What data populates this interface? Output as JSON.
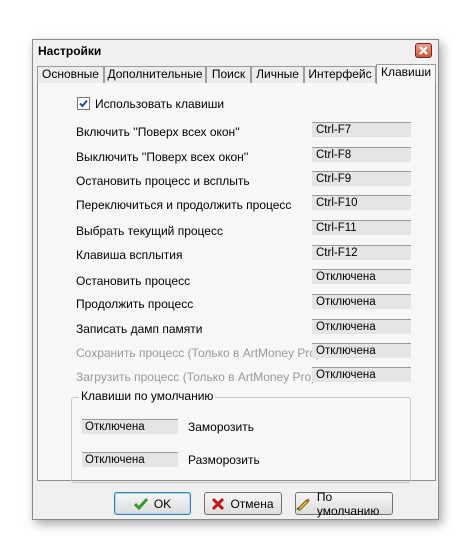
{
  "window": {
    "title": "Настройки"
  },
  "tabs": [
    {
      "label": "Основные"
    },
    {
      "label": "Дополнительные"
    },
    {
      "label": "Поиск"
    },
    {
      "label": "Личные"
    },
    {
      "label": "Интерфейс"
    },
    {
      "label": "Клавиши",
      "active": true
    }
  ],
  "use_hotkeys": {
    "label": "Использовать клавиши",
    "checked": true
  },
  "rows": [
    {
      "label": "Включить ''Поверх всех окон''",
      "value": "Ctrl-F7",
      "enabled": true
    },
    {
      "label": "Выключить ''Поверх всех окон''",
      "value": "Ctrl-F8",
      "enabled": true
    },
    {
      "label": "Остановить процесс и всплыть",
      "value": "Ctrl-F9",
      "enabled": true
    },
    {
      "label": "Переключиться и продолжить процесс",
      "value": "Ctrl-F10",
      "enabled": true
    },
    {
      "label": "Выбрать текущий процесс",
      "value": "Ctrl-F11",
      "enabled": true
    },
    {
      "label": "Клавиша всплытия",
      "value": "Ctrl-F12",
      "enabled": true
    },
    {
      "label": "Остановить процесс",
      "value": "Отключена",
      "enabled": true
    },
    {
      "label": "Продолжить процесс",
      "value": "Отключена",
      "enabled": true
    },
    {
      "label": "Записать дамп памяти",
      "value": "Отключена",
      "enabled": true
    },
    {
      "label": "Сохранить процесс (Только в ArtMoney Pro)",
      "value": "Отключена",
      "enabled": false
    },
    {
      "label": "Загрузить процесс (Только в ArtMoney Pro)",
      "value": "Отключена",
      "enabled": false
    }
  ],
  "defaults_group": {
    "title": "Клавиши по умолчанию",
    "freeze": {
      "value": "Отключена",
      "label": "Заморозить"
    },
    "unfreeze": {
      "value": "Отключена",
      "label": "Разморозить"
    }
  },
  "buttons": {
    "ok": "OK",
    "cancel": "Отмена",
    "default": "По умолчанию"
  },
  "colors": {
    "ok_check": "#2f9a2f",
    "cancel_x": "#c01818",
    "close_button": "#c85a3f"
  },
  "icons": {
    "ok": "check-icon",
    "cancel": "x-icon",
    "default": "pen-icon",
    "close": "close-icon"
  }
}
